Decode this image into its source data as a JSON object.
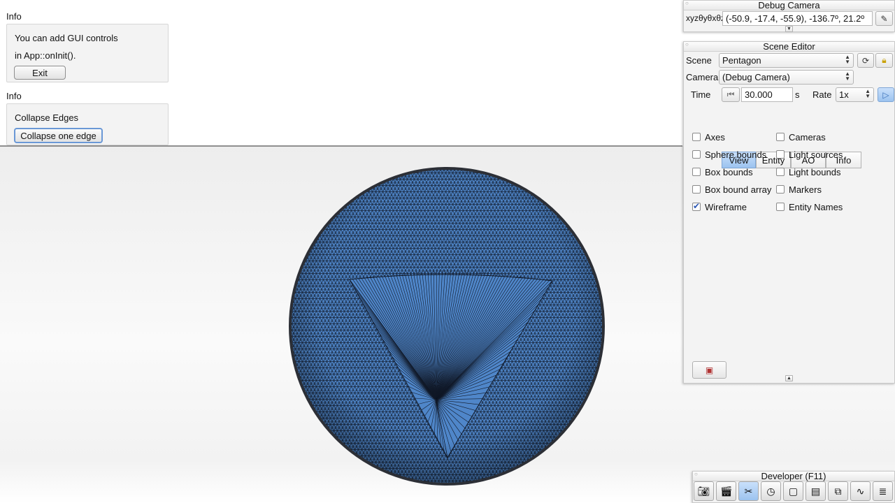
{
  "info_panes": [
    {
      "title": "Info",
      "lines": [
        "You can add GUI controls",
        "in App::onInit()."
      ],
      "button": "Exit"
    },
    {
      "title": "Info",
      "lines": [
        "Collapse Edges"
      ],
      "button": "Collapse one edge"
    }
  ],
  "debug_camera": {
    "title": "Debug Camera",
    "label": "xyzθyθxθz",
    "value": "(-50.9, -17.4, -55.9), -136.7º,  21.2º"
  },
  "scene_editor": {
    "title": "Scene Editor",
    "scene_label": "Scene",
    "scene_value": "Pentagon",
    "camera_label": "Camera",
    "camera_value": "(Debug Camera)",
    "time_label": "Time",
    "time_value": "30.000",
    "time_unit": "s",
    "rate_label": "Rate",
    "rate_value": "1x",
    "tabs": [
      "View",
      "Entity",
      "AO",
      "Info"
    ],
    "active_tab": "View",
    "checkboxes_left": [
      {
        "label": "Axes",
        "checked": false
      },
      {
        "label": "Sphere bounds",
        "checked": false
      },
      {
        "label": "Box bounds",
        "checked": false
      },
      {
        "label": "Box bound array",
        "checked": false
      },
      {
        "label": "Wireframe",
        "checked": true
      }
    ],
    "checkboxes_right": [
      {
        "label": "Cameras",
        "checked": false
      },
      {
        "label": "Light sources",
        "checked": false
      },
      {
        "label": "Light bounds",
        "checked": false
      },
      {
        "label": "Markers",
        "checked": false
      },
      {
        "label": "Entity Names",
        "checked": false
      }
    ]
  },
  "developer": {
    "title": "Developer (F11)",
    "tools": [
      "camera-icon",
      "film-clapper-icon",
      "tools-icon",
      "clock-icon",
      "new-page-icon",
      "terminal-icon",
      "windows-icon",
      "profiler-icon",
      "document-icon"
    ]
  },
  "colors": {
    "sphere_fill": "#4f86c9",
    "wire": "#101827",
    "tab_active": "#9cc3ef"
  }
}
